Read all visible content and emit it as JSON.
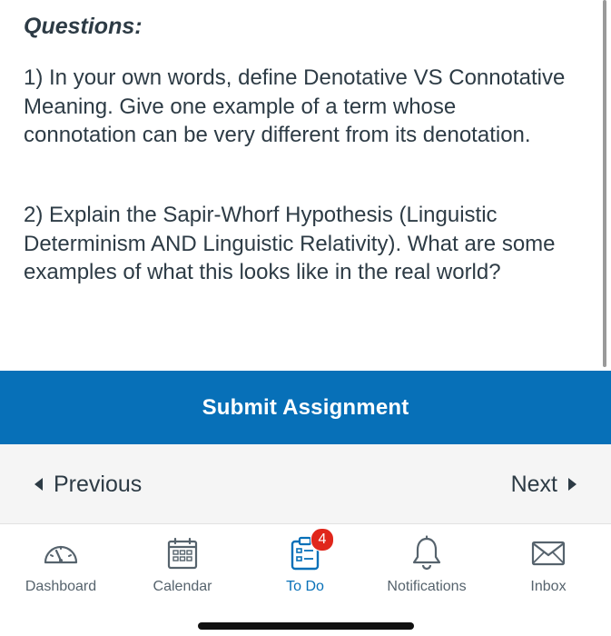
{
  "content": {
    "heading": "Questions:",
    "questions": [
      "1) In your own words, define Denotative VS Connotative Meaning. Give one example of a term whose connotation can be very different from its denotation.",
      "2) Explain the Sapir-Whorf Hypothesis (Linguistic Determinism AND Linguistic Relativity). What are some examples of what this looks like in the real world?"
    ]
  },
  "submit": {
    "label": "Submit Assignment"
  },
  "pager": {
    "previous_label": "Previous",
    "next_label": "Next"
  },
  "tabbar": {
    "tabs": [
      {
        "label": "Dashboard",
        "icon": "dashboard-gauge-icon"
      },
      {
        "label": "Calendar",
        "icon": "calendar-icon"
      },
      {
        "label": "To Do",
        "icon": "todo-clipboard-icon",
        "badge": "4",
        "active": true
      },
      {
        "label": "Notifications",
        "icon": "bell-icon"
      },
      {
        "label": "Inbox",
        "icon": "envelope-icon"
      }
    ]
  },
  "colors": {
    "brand_blue": "#0770b8",
    "text_dark": "#2d3b45",
    "badge_red": "#e0261b",
    "pager_bg": "#f5f5f5"
  }
}
